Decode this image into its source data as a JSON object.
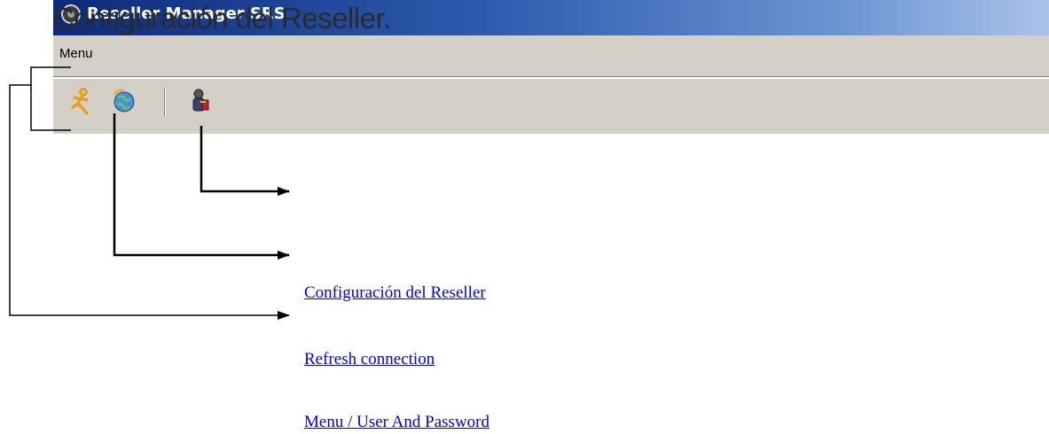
{
  "window": {
    "title": "Reseller Manager SRS"
  },
  "overlay_title": "Configuración del Reseller.",
  "menubar": {
    "items": [
      {
        "label": "Menu"
      }
    ]
  },
  "toolbar": {
    "buttons": [
      {
        "icon": "running-man-icon"
      },
      {
        "icon": "globe-refresh-icon"
      },
      {
        "icon": "user-key-icon"
      }
    ]
  },
  "callouts": {
    "link1": "Configuración del Reseller",
    "link2": "Refresh connection",
    "link3a": "Menu",
    "link3sep": " / ",
    "link3b": "User And Password"
  },
  "colors": {
    "titlebar_start": "#0c2a7a",
    "titlebar_end": "#a9c3ea",
    "chrome": "#d4d0c8",
    "link": "#0000ee"
  }
}
